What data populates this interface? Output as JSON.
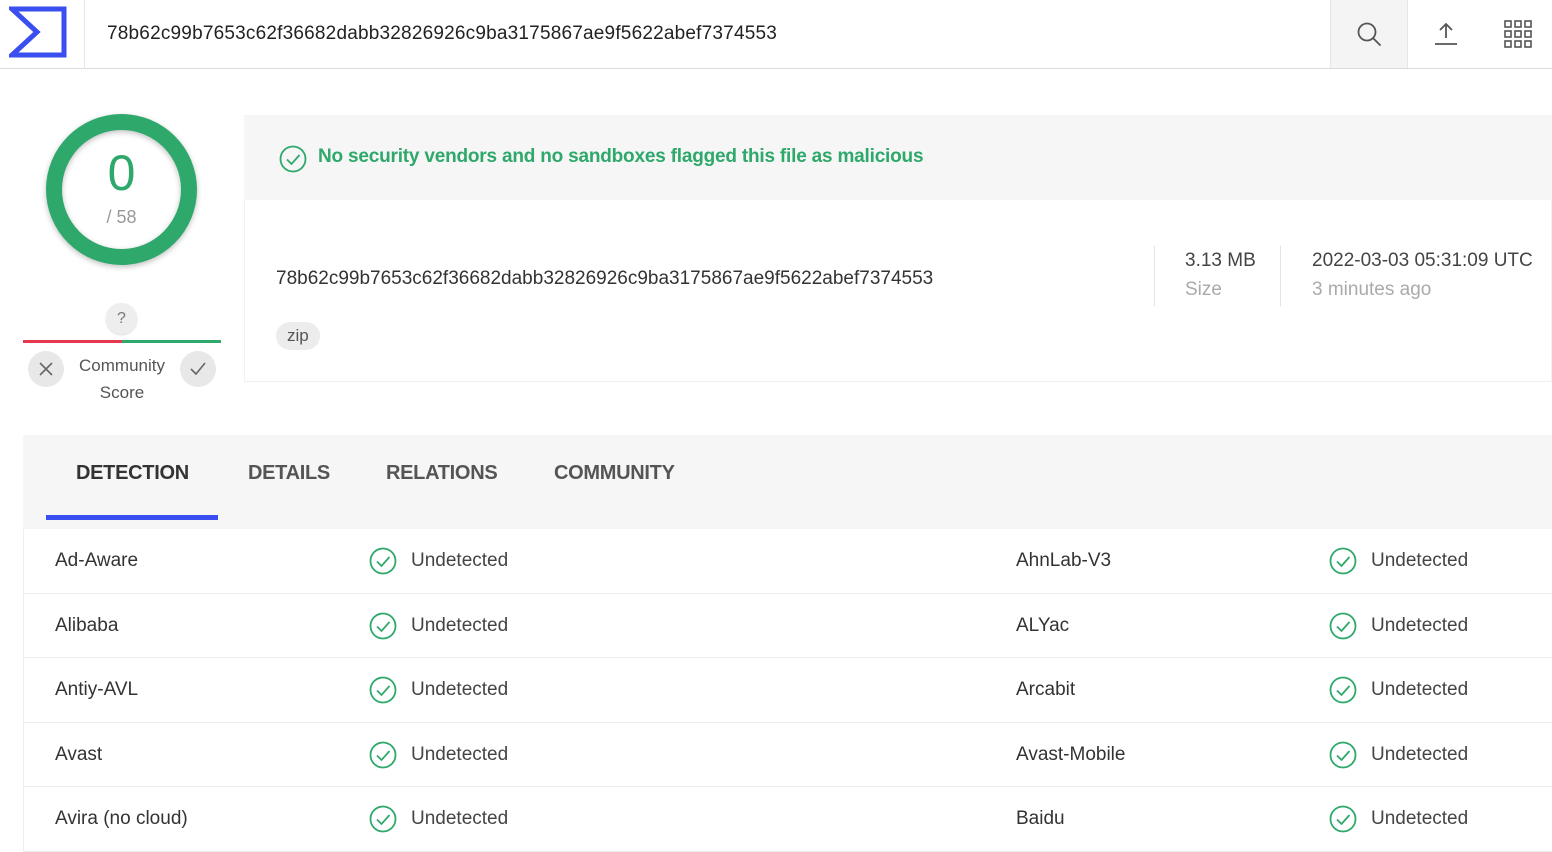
{
  "colors": {
    "clean": "#2ea86b",
    "malicious": "#e53950",
    "accent": "#3b4ff0"
  },
  "search": {
    "value": "78b62c99b7653c62f36682dabb32826926c9ba3175867ae9f5622abef7374553"
  },
  "toolbar": {
    "icons": [
      "search-icon",
      "upload-icon",
      "apps-grid-icon"
    ]
  },
  "score": {
    "detections": "0",
    "total": "/ 58"
  },
  "community": {
    "question": "?",
    "label_line1": "Community",
    "label_line2": "Score"
  },
  "banner": {
    "text": "No security vendors and no sandboxes flagged this file as malicious"
  },
  "file": {
    "hash": "78b62c99b7653c62f36682dabb32826926c9ba3175867ae9f5622abef7374553",
    "tag": "zip",
    "size": "3.13 MB",
    "size_label": "Size",
    "date": "2022-03-03 05:31:09 UTC",
    "date_ago": "3 minutes ago"
  },
  "tabs": [
    {
      "label": "DETECTION",
      "active": true
    },
    {
      "label": "DETAILS",
      "active": false
    },
    {
      "label": "RELATIONS",
      "active": false
    },
    {
      "label": "COMMUNITY",
      "active": false
    }
  ],
  "detections": [
    {
      "left_vendor": "Ad-Aware",
      "left_result": "Undetected",
      "right_vendor": "AhnLab-V3",
      "right_result": "Undetected"
    },
    {
      "left_vendor": "Alibaba",
      "left_result": "Undetected",
      "right_vendor": "ALYac",
      "right_result": "Undetected"
    },
    {
      "left_vendor": "Antiy-AVL",
      "left_result": "Undetected",
      "right_vendor": "Arcabit",
      "right_result": "Undetected"
    },
    {
      "left_vendor": "Avast",
      "left_result": "Undetected",
      "right_vendor": "Avast-Mobile",
      "right_result": "Undetected"
    },
    {
      "left_vendor": "Avira (no cloud)",
      "left_result": "Undetected",
      "right_vendor": "Baidu",
      "right_result": "Undetected"
    }
  ]
}
